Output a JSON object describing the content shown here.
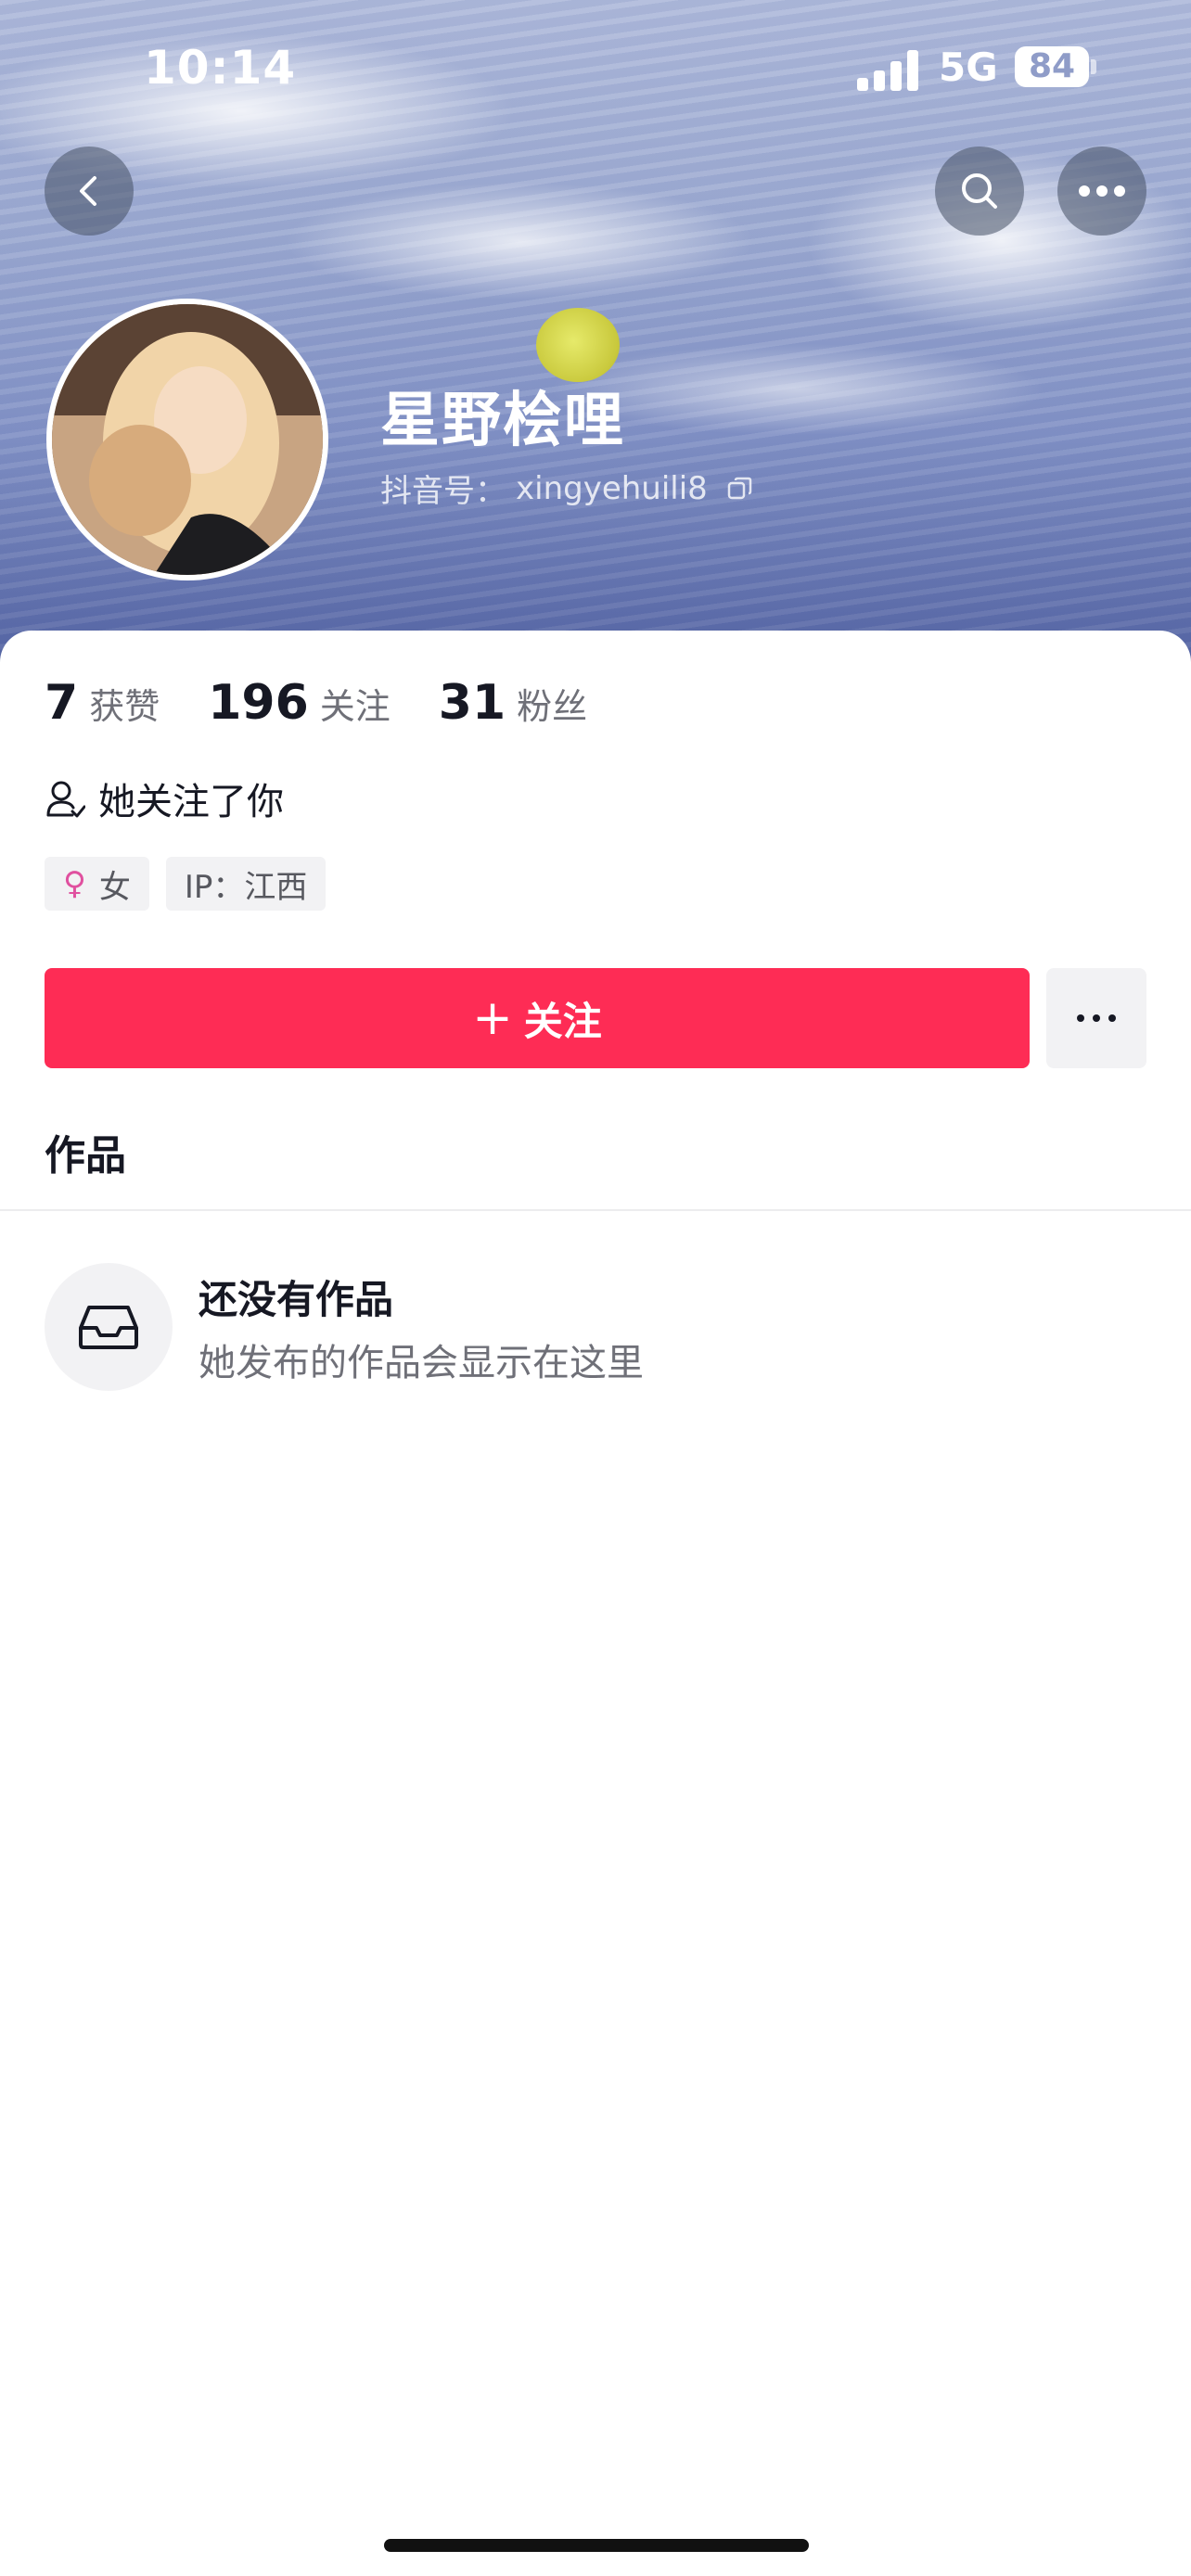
{
  "status_bar": {
    "time": "10:14",
    "network": "5G",
    "battery": "84"
  },
  "header": {
    "icons": {
      "back": "chevron-left-icon",
      "search": "search-icon",
      "more": "more-horizontal-icon"
    }
  },
  "profile": {
    "nickname": "星野桧哩",
    "douyin_id_prefix": "抖音号：",
    "douyin_id": "xingyehuili8",
    "copy_icon": "copy-icon"
  },
  "stats": [
    {
      "value": "7",
      "label": "获赞"
    },
    {
      "value": "196",
      "label": "关注"
    },
    {
      "value": "31",
      "label": "粉丝"
    }
  ],
  "relation": {
    "icon": "person-icon",
    "text": "她关注了你"
  },
  "tags": {
    "gender_symbol": "♀",
    "gender": "女",
    "ip": "IP：江西"
  },
  "actions": {
    "follow_plus": "+",
    "follow_label": "关注",
    "more_icon": "ellipsis-icon"
  },
  "tabs": {
    "works": "作品"
  },
  "empty_state": {
    "icon": "inbox-icon",
    "title": "还没有作品",
    "subtitle": "她发布的作品会显示在这里"
  },
  "colors": {
    "accent": "#fe2c55",
    "text_primary": "#161823",
    "text_secondary": "#6f7078",
    "chip_bg": "#f2f2f4"
  }
}
